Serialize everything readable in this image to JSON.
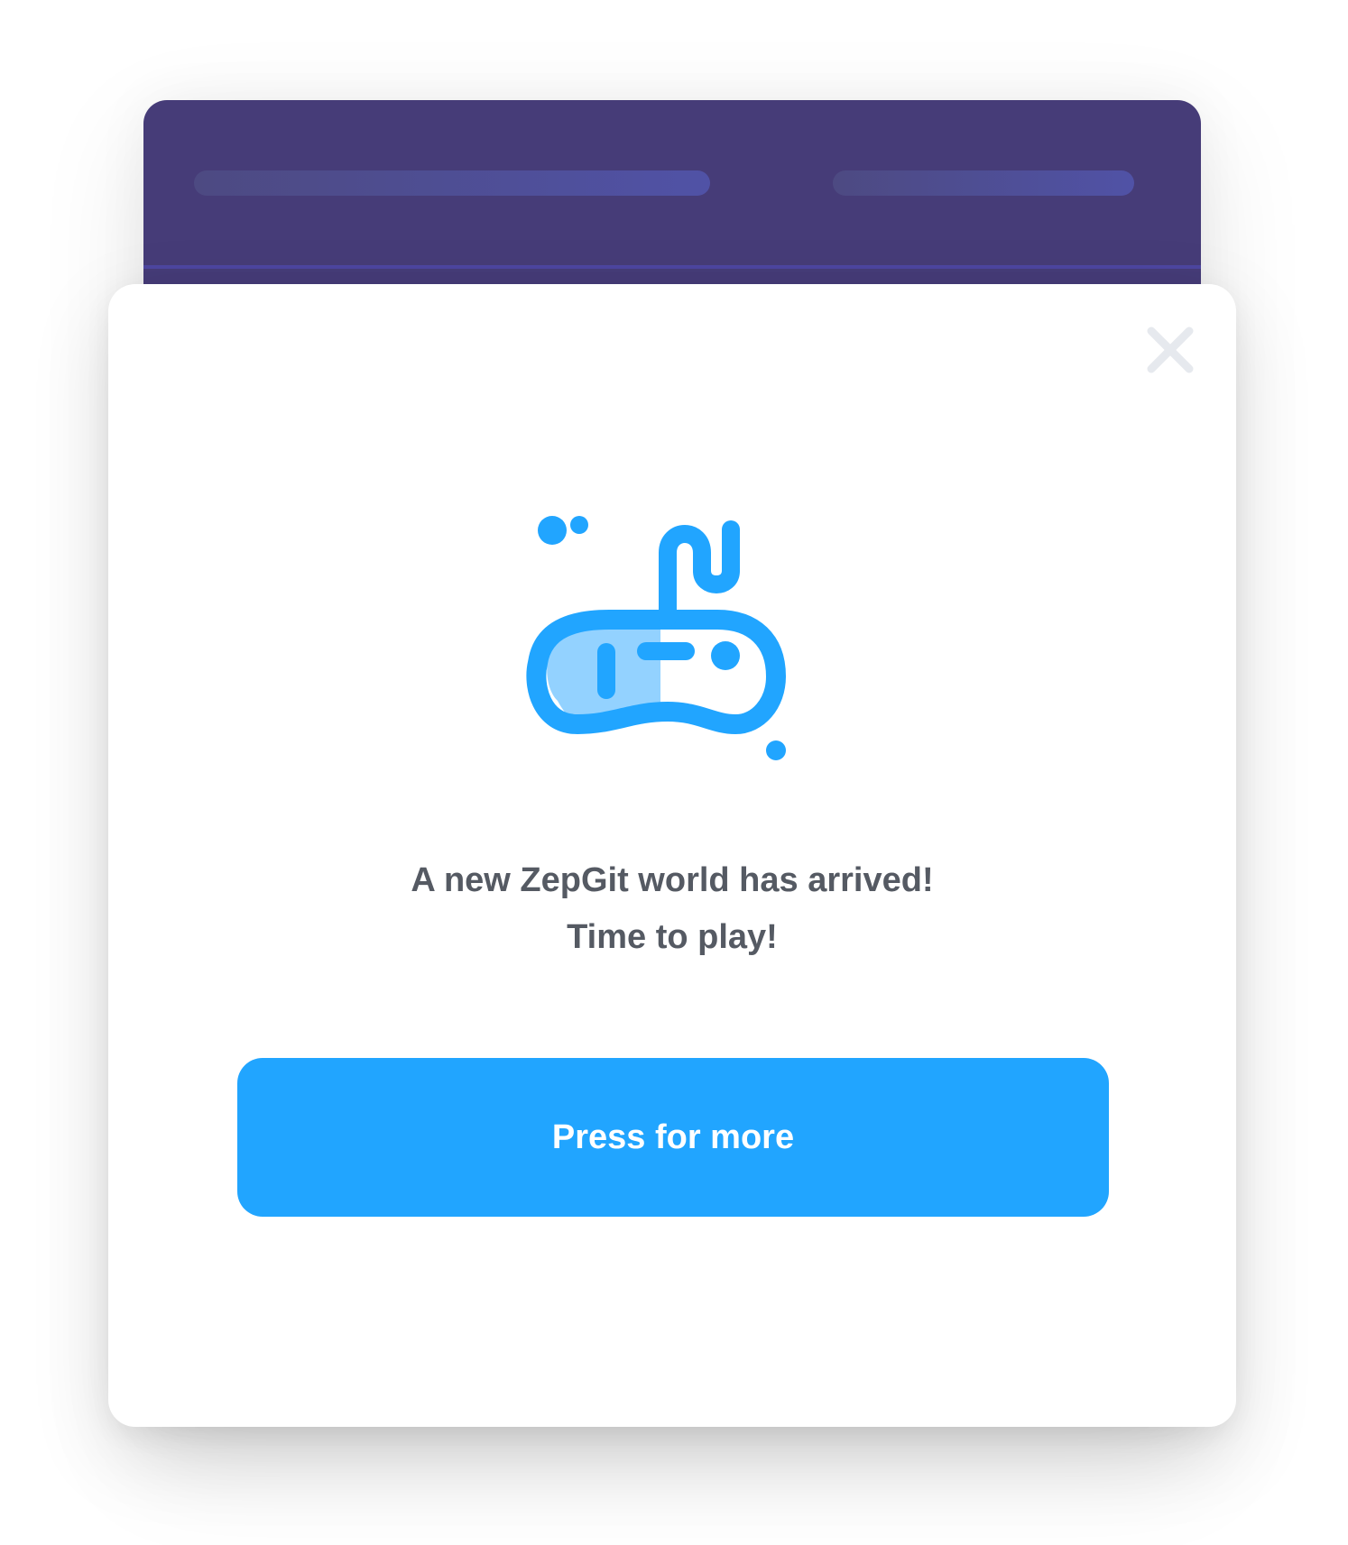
{
  "colors": {
    "background": "#ffffff",
    "back_window": "#463c78",
    "placeholder_bar": "#5052a6",
    "modal": "#ffffff",
    "accent_blue": "#21a5ff",
    "light_blue": "#93d2ff",
    "close_icon": "#e6e9ee",
    "message_text": "#555a63",
    "button_text": "#ffffff"
  },
  "modal": {
    "close_icon": "close-icon",
    "illustration_icon": "gamepad-icon",
    "message_line_1": "A new ZepGit world has arrived!",
    "message_line_2": "Time to play!",
    "cta_label": "Press for more"
  }
}
